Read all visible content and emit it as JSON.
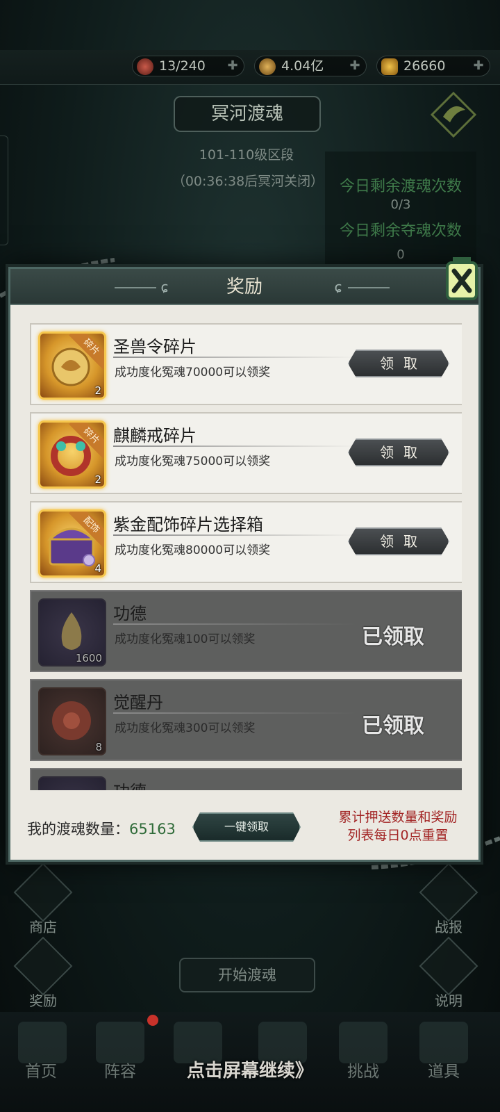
{
  "resources": [
    {
      "icon": "soul-orb-icon",
      "value": "13/240"
    },
    {
      "icon": "coin-icon",
      "value": "4.04亿"
    },
    {
      "icon": "ingot-icon",
      "value": "26660"
    }
  ],
  "header": {
    "title": "冥河渡魂",
    "level_range": "101-110级区段",
    "countdown": "（00:36:38后冥河关闭）"
  },
  "counts": {
    "ferry_label": "今日剩余渡魂次数",
    "ferry_value": "0/3",
    "steal_label": "今日剩余夺魂次数",
    "steal_value": "0"
  },
  "modal": {
    "title": "奖励",
    "rewards": [
      {
        "name": "圣兽令碎片",
        "desc": "成功度化冤魂70000可以领奖",
        "qty": "2",
        "tag": "碎片",
        "state": "claim",
        "button": "领取"
      },
      {
        "name": "麒麟戒碎片",
        "desc": "成功度化冤魂75000可以领奖",
        "qty": "2",
        "tag": "碎片",
        "state": "claim",
        "button": "领取"
      },
      {
        "name": "紫金配饰碎片选择箱",
        "desc": "成功度化冤魂80000可以领奖",
        "qty": "4",
        "tag": "配饰",
        "state": "claim",
        "button": "领取"
      },
      {
        "name": "功德",
        "desc": "成功度化冤魂100可以领奖",
        "qty": "1600",
        "tag": "",
        "state": "claimed",
        "button": "已领取"
      },
      {
        "name": "觉醒丹",
        "desc": "成功度化冤魂300可以领奖",
        "qty": "8",
        "tag": "",
        "state": "claimed",
        "button": "已领取"
      },
      {
        "name": "功德",
        "desc": "",
        "qty": "",
        "tag": "",
        "state": "claimed",
        "button": ""
      }
    ],
    "footer_label": "我的渡魂数量：",
    "footer_value": "65163",
    "bulk_button": "一键领取",
    "reset_note_1": "累计押送数量和奖励",
    "reset_note_2": "列表每日0点重置"
  },
  "side_buttons": {
    "shop": "商店",
    "reward": "奖励",
    "report": "战报",
    "help": "说明"
  },
  "start_button": "开始渡魂",
  "tabs": [
    "首页",
    "阵容",
    "挑战",
    "道具"
  ],
  "continue_hint": "点击屏幕继续》",
  "colors": {
    "accent_green": "#2f6b39",
    "reset_red": "#a32626",
    "gold_frame": "#f6c74e"
  }
}
